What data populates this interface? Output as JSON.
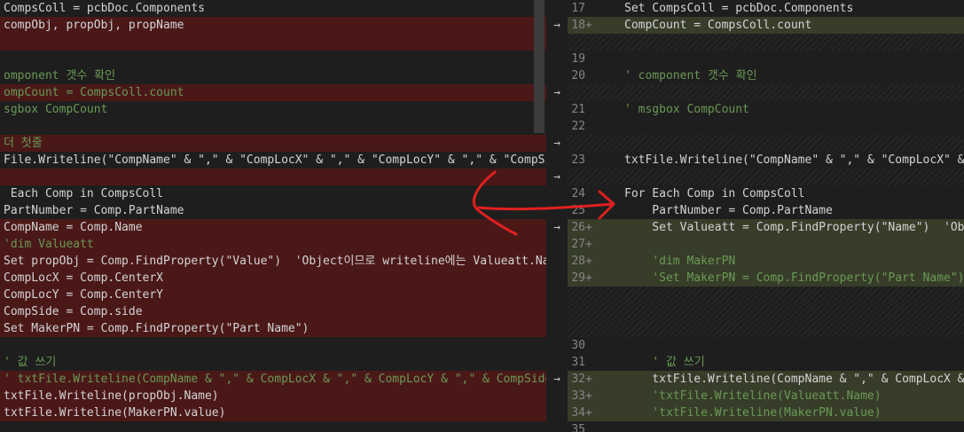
{
  "left": {
    "lines": [
      {
        "t": "CompsColl = pcbDoc.Components",
        "bg": "",
        "cls": ""
      },
      {
        "t": "compObj, propObj, propName",
        "bg": "del",
        "cls": ""
      },
      {
        "t": "",
        "bg": "del",
        "cls": ""
      },
      {
        "t": "",
        "bg": "",
        "cls": ""
      },
      {
        "t": "omponent 갯수 확인",
        "bg": "",
        "cls": "cm"
      },
      {
        "t": "ompCount = CompsColl.count",
        "bg": "del",
        "cls": "cm"
      },
      {
        "t": "sgbox CompCount",
        "bg": "",
        "cls": "cm"
      },
      {
        "t": "",
        "bg": "",
        "cls": ""
      },
      {
        "t": "더 첫줄",
        "bg": "del",
        "cls": "cm"
      },
      {
        "t": "File.Writeline(\"CompName\" & \",\" & \"CompLocX\" & \",\" & \"CompLocY\" & \",\" & \"CompSide\"",
        "bg": "",
        "cls": ""
      },
      {
        "t": "",
        "bg": "del",
        "cls": ""
      },
      {
        "t": " Each Comp in CompsColl",
        "bg": "",
        "cls": ""
      },
      {
        "t": "PartNumber = Comp.PartName",
        "bg": "",
        "cls": ""
      },
      {
        "t": "CompName = Comp.Name",
        "bg": "del",
        "cls": ""
      },
      {
        "t": "'dim Valueatt",
        "bg": "del",
        "cls": "cm"
      },
      {
        "t": "Set propObj = Comp.FindProperty(\"Value\")  'Object이므로 writeline에는 Valueatt.Na",
        "bg": "del",
        "cls": ""
      },
      {
        "t": "CompLocX = Comp.CenterX",
        "bg": "del",
        "cls": ""
      },
      {
        "t": "CompLocY = Comp.CenterY",
        "bg": "del",
        "cls": ""
      },
      {
        "t": "CompSide = Comp.side",
        "bg": "del",
        "cls": ""
      },
      {
        "t": "Set MakerPN = Comp.FindProperty(\"Part Name\")",
        "bg": "del",
        "cls": ""
      },
      {
        "t": "",
        "bg": "",
        "cls": ""
      },
      {
        "t": "' 값 쓰기",
        "bg": "",
        "cls": "cm"
      },
      {
        "t": "' txtFile.Writeline(CompName & \",\" & CompLocX & \",\" & CompLocY & \",\" & CompSide",
        "bg": "del",
        "cls": "cm"
      },
      {
        "t": "txtFile.Writeline(propObj.Name)",
        "bg": "del",
        "cls": ""
      },
      {
        "t": "txtFile.Writeline(MakerPN.value)",
        "bg": "del",
        "cls": ""
      },
      {
        "t": "",
        "bg": "",
        "cls": ""
      }
    ]
  },
  "right": {
    "lines": [
      {
        "n": "17",
        "p": "",
        "t": "Set CompsColl = pcbDoc.Components",
        "bg": "",
        "cls": ""
      },
      {
        "n": "18",
        "p": "+",
        "t": "CompCount = CompsColl.count",
        "bg": "ins",
        "cls": ""
      },
      {
        "n": "",
        "p": "",
        "t": "",
        "bg": "hatch",
        "cls": ""
      },
      {
        "n": "19",
        "p": "",
        "t": "",
        "bg": "",
        "cls": ""
      },
      {
        "n": "20",
        "p": "",
        "t": "' component 갯수 확인",
        "bg": "",
        "cls": "cm"
      },
      {
        "n": "",
        "p": "",
        "t": "",
        "bg": "hatch",
        "cls": ""
      },
      {
        "n": "21",
        "p": "",
        "t": "' msgbox CompCount",
        "bg": "",
        "cls": "cm"
      },
      {
        "n": "22",
        "p": "",
        "t": "",
        "bg": "",
        "cls": ""
      },
      {
        "n": "",
        "p": "",
        "t": "",
        "bg": "hatch",
        "cls": ""
      },
      {
        "n": "23",
        "p": "",
        "t": "txtFile.Writeline(\"CompName\" & \",\" & \"CompLocX\" &",
        "bg": "",
        "cls": ""
      },
      {
        "n": "",
        "p": "",
        "t": "",
        "bg": "hatch",
        "cls": ""
      },
      {
        "n": "24",
        "p": "",
        "t": "For Each Comp in CompsColl",
        "bg": "",
        "cls": ""
      },
      {
        "n": "25",
        "p": "",
        "t": "    PartNumber = Comp.PartName",
        "bg": "",
        "cls": ""
      },
      {
        "n": "26",
        "p": "+",
        "t": "    Set Valueatt = Comp.FindProperty(\"Name\")  'Obj",
        "bg": "ins",
        "cls": ""
      },
      {
        "n": "27",
        "p": "+",
        "t": "",
        "bg": "ins",
        "cls": ""
      },
      {
        "n": "28",
        "p": "+",
        "t": "    'dim MakerPN",
        "bg": "ins",
        "cls": "cm"
      },
      {
        "n": "29",
        "p": "+",
        "t": "    'Set MakerPN = Comp.FindProperty(\"Part Name\")",
        "bg": "ins",
        "cls": "cm"
      },
      {
        "n": "",
        "p": "",
        "t": "",
        "bg": "hatch",
        "cls": ""
      },
      {
        "n": "",
        "p": "",
        "t": "",
        "bg": "hatch",
        "cls": ""
      },
      {
        "n": "",
        "p": "",
        "t": "",
        "bg": "hatch",
        "cls": ""
      },
      {
        "n": "30",
        "p": "",
        "t": "",
        "bg": "",
        "cls": ""
      },
      {
        "n": "31",
        "p": "",
        "t": "    ' 값 쓰기",
        "bg": "",
        "cls": "cm"
      },
      {
        "n": "32",
        "p": "+",
        "t": "    txtFile.Writeline(CompName & \",\" & CompLocX &",
        "bg": "ins",
        "cls": ""
      },
      {
        "n": "33",
        "p": "+",
        "t": "    'txtFile.Writeline(Valueatt.Name)",
        "bg": "ins",
        "cls": "cm"
      },
      {
        "n": "34",
        "p": "+",
        "t": "    'txtFile.Writeline(MakerPN.value)",
        "bg": "ins",
        "cls": "cm"
      },
      {
        "n": "35",
        "p": "",
        "t": "",
        "bg": "",
        "cls": ""
      }
    ]
  },
  "gutter": {
    "arrow_glyph": "→",
    "arrows": [
      1,
      5,
      8,
      10,
      13,
      22
    ]
  },
  "colors": {
    "deleted_line": "#4b1818",
    "inserted_line": "#373d29",
    "annotation": "#e0201f"
  },
  "icons": [
    "revert-change-arrow-icon"
  ]
}
